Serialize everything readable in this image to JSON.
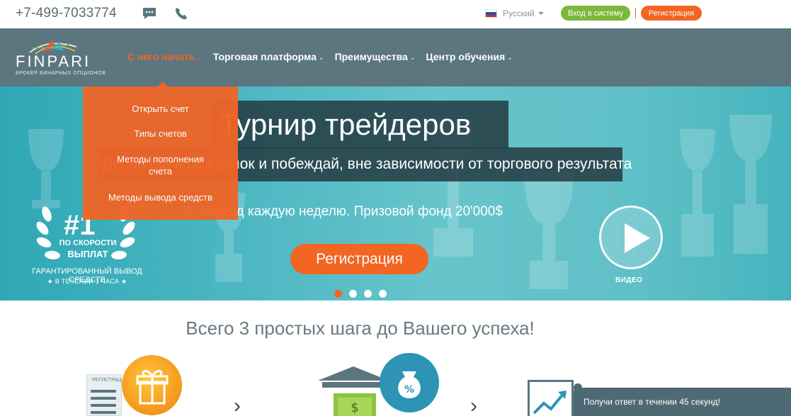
{
  "topbar": {
    "phone": "+7-499-7033774",
    "chat_icon": "chat-icon",
    "call_icon": "phone-icon",
    "language": "Русский",
    "login_label": "Вход в систему",
    "register_label": "Регистрация"
  },
  "nav": {
    "logo_text": "FINPARI",
    "logo_subtitle": "БРОКЕР БИНАРНЫХ ОПЦИОНОВ",
    "items": [
      {
        "label": "С чего начать"
      },
      {
        "label": "Торговая платформа"
      },
      {
        "label": "Преимущества"
      },
      {
        "label": "Центр обучения"
      }
    ],
    "dropdown": [
      {
        "label": "Открыть счет"
      },
      {
        "label": "Типы счетов"
      },
      {
        "label": "Методы пополнения счета"
      },
      {
        "label": "Методы вывода средств"
      }
    ]
  },
  "hero": {
    "title": "Турнир трейдеров",
    "subtitle": "Делай больше сделок и побеждай, вне зависимости от торгового результата",
    "prize": "20 наград каждую неделю. Призовой фонд 20'000$",
    "register_label": "Регистрация",
    "video_label": "ВИДЕО",
    "badge": {
      "number": "#1",
      "line1": "ПО СКОРОСТИ",
      "line2": "ВЫПЛАТ",
      "line3": "ГАРАНТИРОВАННЫЙ ВЫВОД СРЕДСТВ",
      "line4": "★ В ТЕЧЕНИИ 1 ЧАСА ★"
    },
    "slides": 4,
    "active_slide": 1
  },
  "steps": {
    "title": "Всего 3 простых шага до Вашего успеха!",
    "doc_label": "РЕГИСТРАЦ"
  },
  "chat_widget": {
    "label": "Получи ответ в течении 45 секунд!"
  },
  "colors": {
    "accent": "#f26522",
    "nav_bg": "#5c7680",
    "login_green": "#7cb83c",
    "hero_teal": "#4cb7c2"
  }
}
